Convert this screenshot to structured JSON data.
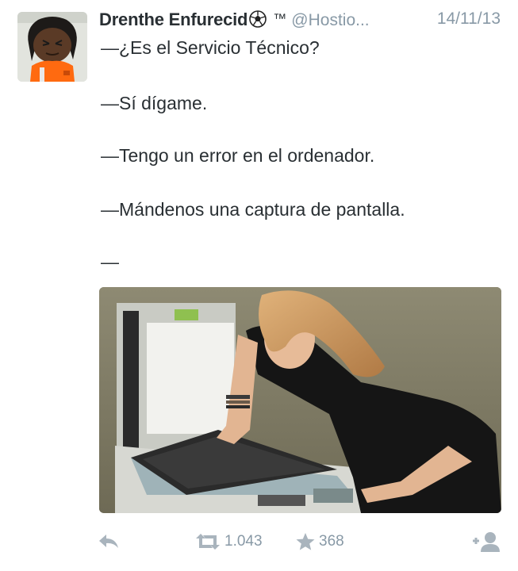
{
  "tweet": {
    "display_name": "Drenthe Enfurecid",
    "name_icon": "soccer-ball-icon",
    "trademark": "™",
    "handle": "@Hostio...",
    "timestamp": "14/11/13",
    "avatar_icon": "cartoon-avatar",
    "lines": [
      "—¿Es el Servicio Técnico?",
      "—Sí dígame.",
      "—Tengo un error en el ordenador.",
      "—Mándenos una captura de pantalla.",
      "—"
    ],
    "media_icon": "photo-woman-at-photocopier"
  },
  "actions": {
    "reply_icon": "reply-icon",
    "retweet_icon": "retweet-icon",
    "retweet_count": "1.043",
    "favorite_icon": "star-icon",
    "favorite_count": "368",
    "follow_icon": "follow-user-icon"
  },
  "colors": {
    "text": "#292f33",
    "muted": "#8899a6",
    "icon": "#a9b4bd",
    "background": "#ffffff"
  }
}
